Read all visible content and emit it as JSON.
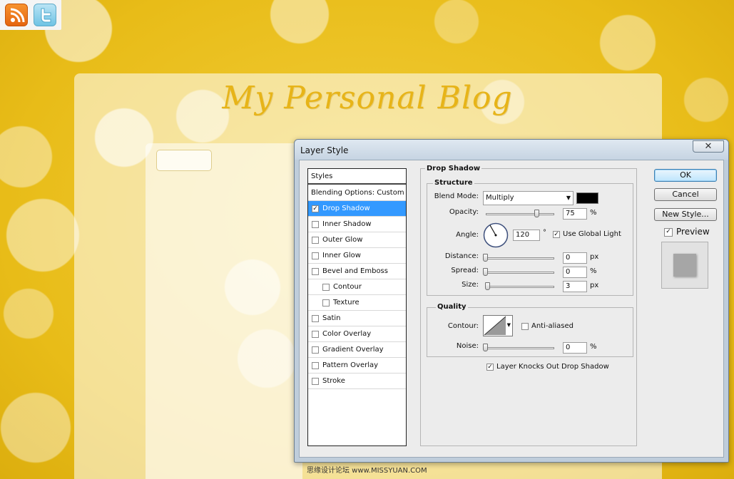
{
  "background": {
    "blog_title": "My Personal Blog",
    "accent_color": "#e8bf1c",
    "social_icons": [
      "rss-icon",
      "twitter-icon"
    ],
    "watermark": "思缘设计论坛 www.MISSYUAN.COM"
  },
  "dialog": {
    "title": "Layer Style",
    "close_symbol": "✕",
    "styles_list": {
      "header": "Styles",
      "blending_options": "Blending Options: Custom",
      "items": [
        {
          "label": "Drop Shadow",
          "checked": true,
          "selected": true,
          "indent": false
        },
        {
          "label": "Inner Shadow",
          "checked": false,
          "selected": false,
          "indent": false
        },
        {
          "label": "Outer Glow",
          "checked": false,
          "selected": false,
          "indent": false
        },
        {
          "label": "Inner Glow",
          "checked": false,
          "selected": false,
          "indent": false
        },
        {
          "label": "Bevel and Emboss",
          "checked": false,
          "selected": false,
          "indent": false
        },
        {
          "label": "Contour",
          "checked": false,
          "selected": false,
          "indent": true
        },
        {
          "label": "Texture",
          "checked": false,
          "selected": false,
          "indent": true
        },
        {
          "label": "Satin",
          "checked": false,
          "selected": false,
          "indent": false
        },
        {
          "label": "Color Overlay",
          "checked": false,
          "selected": false,
          "indent": false
        },
        {
          "label": "Gradient Overlay",
          "checked": false,
          "selected": false,
          "indent": false
        },
        {
          "label": "Pattern Overlay",
          "checked": false,
          "selected": false,
          "indent": false
        },
        {
          "label": "Stroke",
          "checked": false,
          "selected": false,
          "indent": false
        }
      ]
    },
    "drop_shadow": {
      "section_title": "Drop Shadow",
      "structure": {
        "title": "Structure",
        "blend_mode_label": "Blend Mode:",
        "blend_mode_value": "Multiply",
        "shadow_color": "#000000",
        "opacity_label": "Opacity:",
        "opacity_value": "75",
        "opacity_unit": "%",
        "opacity_fraction": 0.75,
        "angle_label": "Angle:",
        "angle_value": "120",
        "angle_unit": "°",
        "use_global_light_label": "Use Global Light",
        "use_global_light_checked": true,
        "distance_label": "Distance:",
        "distance_value": "0",
        "distance_unit": "px",
        "spread_label": "Spread:",
        "spread_value": "0",
        "spread_unit": "%",
        "size_label": "Size:",
        "size_value": "3",
        "size_unit": "px"
      },
      "quality": {
        "title": "Quality",
        "contour_label": "Contour:",
        "anti_aliased_label": "Anti-aliased",
        "anti_aliased_checked": false,
        "noise_label": "Noise:",
        "noise_value": "0",
        "noise_unit": "%"
      },
      "layer_knocks_out_label": "Layer Knocks Out Drop Shadow",
      "layer_knocks_out_checked": true
    },
    "buttons": {
      "ok": "OK",
      "cancel": "Cancel",
      "new_style": "New Style...",
      "preview_label": "Preview",
      "preview_checked": true
    }
  }
}
